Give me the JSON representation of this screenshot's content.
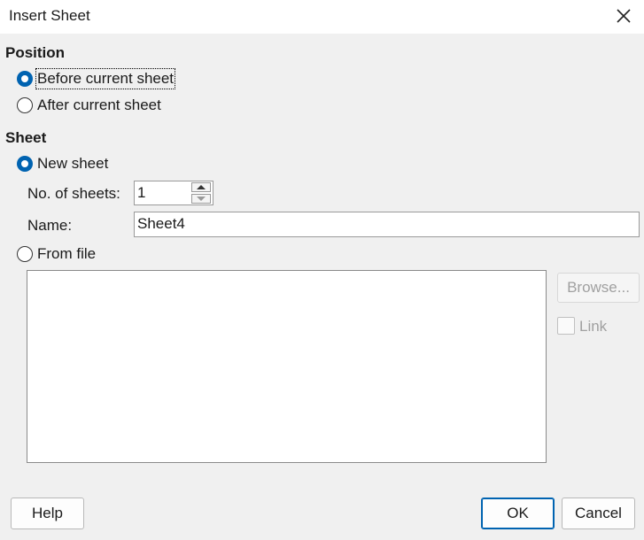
{
  "window": {
    "title": "Insert Sheet"
  },
  "position": {
    "heading": "Position",
    "before": {
      "label": "Before current sheet",
      "selected": true
    },
    "after": {
      "label": "After current sheet",
      "selected": false
    }
  },
  "sheet": {
    "heading": "Sheet",
    "new_sheet": {
      "label": "New sheet",
      "selected": true
    },
    "num_label": "No. of sheets:",
    "num_value": "1",
    "name_label": "Name:",
    "name_value": "Sheet4",
    "from_file": {
      "label": "From file",
      "selected": false
    },
    "browse_label": "Browse...",
    "link_label": "Link"
  },
  "buttons": {
    "help": "Help",
    "ok": "OK",
    "cancel": "Cancel"
  },
  "colors": {
    "accent": "#0063b1",
    "disabled": "#a0a0a0"
  }
}
